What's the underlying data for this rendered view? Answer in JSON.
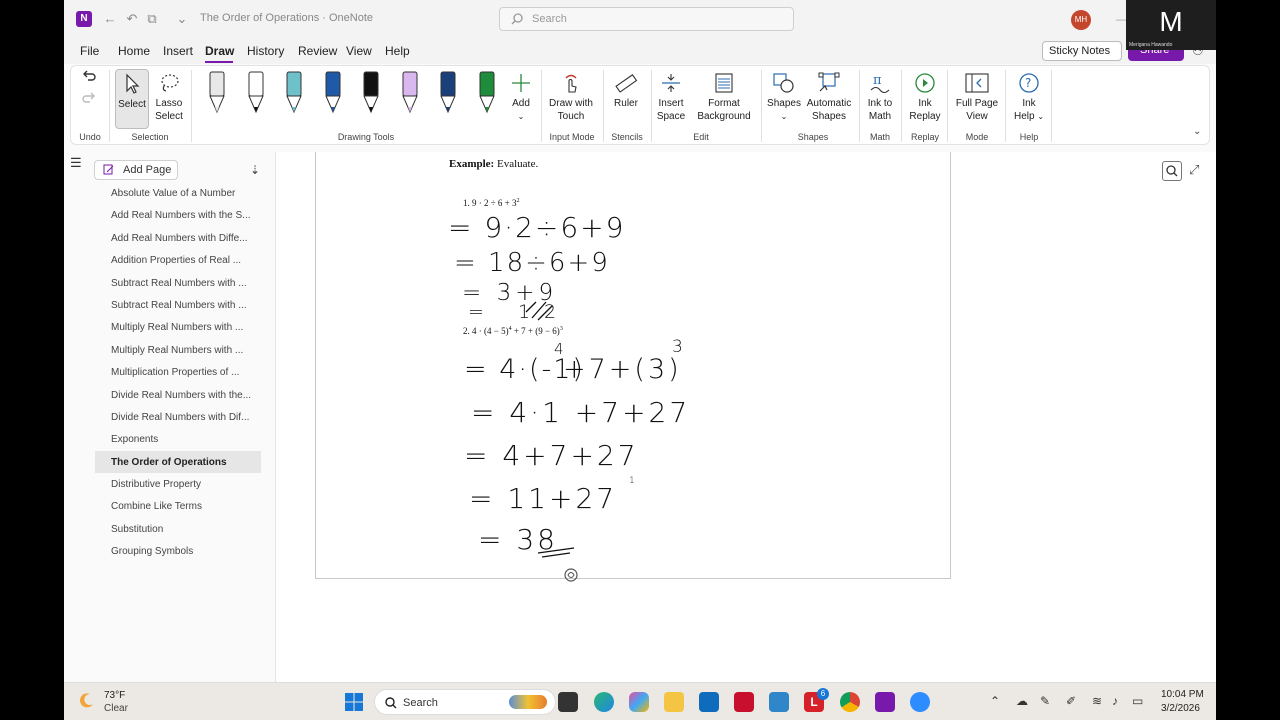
{
  "window": {
    "title": "The Order of Operations · OneNote",
    "search_placeholder": "Search",
    "avatar_initials": "MH"
  },
  "menu": {
    "items": [
      "File",
      "Home",
      "Insert",
      "Draw",
      "History",
      "Review",
      "View",
      "Help"
    ],
    "active": "Draw",
    "sticky_notes": "Sticky Notes",
    "share": "Share"
  },
  "ribbon": {
    "select": "Select",
    "lasso_select": "Lasso Select",
    "add": "Add",
    "draw_with_touch": "Draw with Touch",
    "ruler": "Ruler",
    "insert_space": "Insert Space",
    "format_background": "Format Background",
    "shapes": "Shapes",
    "automatic_shapes": "Automatic Shapes",
    "ink_to_math": "Ink to Math",
    "ink_replay": "Ink Replay",
    "full_page_view": "Full Page View",
    "ink_help": "Ink Help",
    "groups": {
      "undo": "Undo",
      "selection": "Selection",
      "drawing_tools": "Drawing Tools",
      "input_mode": "Input Mode",
      "stencils": "Stencils",
      "edit": "Edit",
      "shapes": "Shapes",
      "math": "Math",
      "replay": "Replay",
      "mode": "Mode",
      "help": "Help"
    },
    "pens": [
      {
        "name": "pen-gray",
        "color": "#e8e8e8"
      },
      {
        "name": "pen-black-a",
        "color": "#ffffff"
      },
      {
        "name": "pen-galaxy",
        "color": "#6ec1c9"
      },
      {
        "name": "pen-blue",
        "color": "#1e5aa8"
      },
      {
        "name": "pen-black",
        "color": "#111111"
      },
      {
        "name": "highlighter-lavender",
        "color": "#d9b8f0"
      },
      {
        "name": "pen-navy",
        "color": "#1b3f7a"
      },
      {
        "name": "pen-green",
        "color": "#1e8c3a"
      }
    ]
  },
  "sidebar": {
    "add_page": "Add Page",
    "pages": [
      "Absolute Value of a Number",
      "Add Real Numbers with the S...",
      "Add Real Numbers with Diffe...",
      "Addition Properties of Real ...",
      "Subtract Real Numbers with ...",
      "Subtract Real Numbers with ...",
      "Multiply Real Numbers with ...",
      "Multiply Real Numbers with ...",
      "Multiplication Properties of ...",
      "Divide Real Numbers with the...",
      "Divide Real Numbers with Dif...",
      "Exponents",
      "The Order of Operations",
      "Distributive Property",
      "Combine Like Terms",
      "Substitution",
      "Grouping Symbols"
    ],
    "active_index": 12
  },
  "document": {
    "example_label": "Example:",
    "example_text": "Evaluate.",
    "problem1": "1.  9 · 2 ÷ 6 + 3",
    "problem1_exp": "2",
    "problem2": "2.  4 · (4 − 5)",
    "problem2_exp1": "4",
    "problem2_mid": " + 7 + (9 − 6)",
    "problem2_exp2": "3",
    "handwriting": {
      "line1": "= 9·2÷6+9",
      "line2": "= 18÷6+9",
      "line3": "= 3+9",
      "line4": "= 12",
      "line5": "= 4·(-1)",
      "line5_exp": "4",
      "line5_rest": "+7+(3)",
      "line5_exp2": "3",
      "line6": "= 4·1 +7+27",
      "line7": "= 4+7+27",
      "line8": "= 11+27",
      "line8_mark": "1",
      "line9": "= 38"
    },
    "ink_color": "#111111"
  },
  "taskbar": {
    "weather_temp": "73°F",
    "weather_condition": "Clear",
    "search": "Search",
    "time": "10:04 PM",
    "date": "3/2/2026",
    "notification_badge": "6"
  },
  "zoom_overlay": {
    "letter": "M",
    "name": "Merigana Hawando"
  }
}
